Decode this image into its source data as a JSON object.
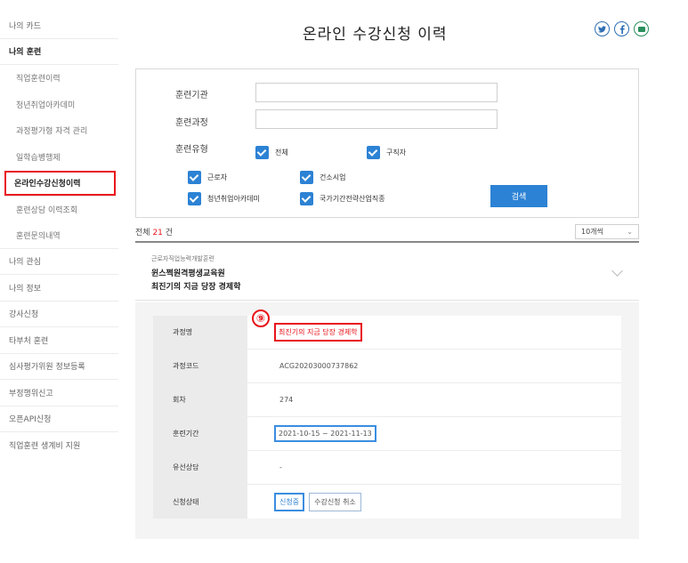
{
  "page_title": "온라인 수강신청 이력",
  "sidebar": {
    "items": [
      {
        "label": "나의 카드",
        "type": "top"
      },
      {
        "label": "나의 훈련",
        "type": "bold"
      },
      {
        "label": "직업훈련이력",
        "type": "sub"
      },
      {
        "label": "청년취업아카데미",
        "type": "sub"
      },
      {
        "label": "과정평가형 자격 관리",
        "type": "sub"
      },
      {
        "label": "일학습병행제",
        "type": "sub"
      },
      {
        "label": "온라인수강신청이력",
        "type": "active"
      },
      {
        "label": "훈련상담 이력조회",
        "type": "sub"
      },
      {
        "label": "훈련문의내역",
        "type": "sub"
      },
      {
        "label": "나의 관심",
        "type": "top"
      },
      {
        "label": "나의 정보",
        "type": "top"
      },
      {
        "label": "강사신청",
        "type": "top"
      },
      {
        "label": "타부처 훈련",
        "type": "top"
      },
      {
        "label": "심사평가위원 정보등록",
        "type": "top"
      },
      {
        "label": "부정행위신고",
        "type": "top"
      },
      {
        "label": "오픈API신청",
        "type": "top"
      },
      {
        "label": "직업훈련 생계비 지원",
        "type": "top"
      }
    ]
  },
  "share_icons": [
    "twitter-icon",
    "facebook-icon",
    "message-icon"
  ],
  "search": {
    "institution_label": "훈련기관",
    "institution_value": "",
    "course_label": "훈련과정",
    "course_value": "",
    "type_label": "훈련유형",
    "checkboxes": {
      "all": "전체",
      "jobseeker": "구직자",
      "worker": "근로자",
      "construction": "건소시업",
      "youth_academy": "청년취업아카데미",
      "national_strategy": "국가기간전략산업직종"
    },
    "button": "검색"
  },
  "results": {
    "prefix": "전체",
    "count": "21",
    "suffix": "건",
    "page_size": "10개씩",
    "page_size_arrow": "⌄"
  },
  "course": {
    "category": "근로자직업능력개발훈련",
    "institution": "윈스쩍원격평생교육원",
    "name": "최진기의 지금 당장 경제학"
  },
  "detail": {
    "marker": "⑨",
    "rows": {
      "course_name": {
        "key": "과정명",
        "value": "최진기의 지금 당장 경제학"
      },
      "course_code": {
        "key": "과정코드",
        "value": "ACG20203000737862"
      },
      "round": {
        "key": "회차",
        "value": "274"
      },
      "period": {
        "key": "훈련기간",
        "value": "2021-10-15 ~ 2021-11-13"
      },
      "consult": {
        "key": "유선상담",
        "value": "-"
      },
      "status": {
        "key": "신청상태",
        "value": "신청중",
        "cancel": "수강신청 취소"
      }
    }
  },
  "colors": {
    "accent_blue": "#2c82d4",
    "highlight_red": "#e8131b",
    "highlight_blue": "#3a8de0"
  }
}
